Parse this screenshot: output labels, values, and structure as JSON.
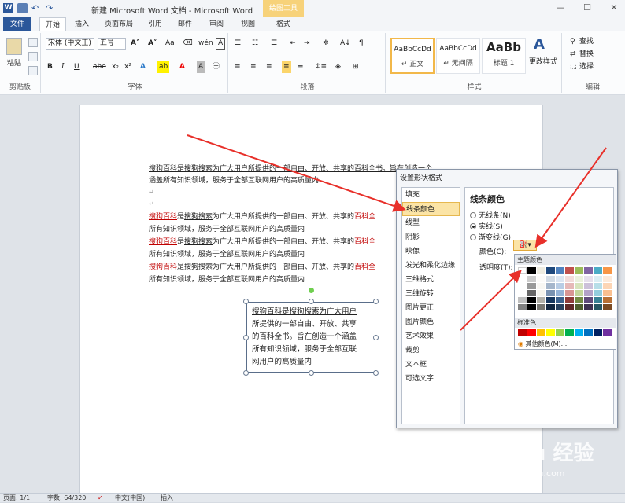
{
  "window": {
    "title": "新建 Microsoft Word 文档 - Microsoft Word",
    "context_tab_group": "绘图工具"
  },
  "tabs": [
    "文件",
    "开始",
    "插入",
    "页面布局",
    "引用",
    "邮件",
    "审阅",
    "视图",
    "格式"
  ],
  "ribbon": {
    "clipboard": {
      "label": "剪贴板",
      "paste": "粘贴"
    },
    "font": {
      "label": "字体",
      "font_name": "宋体 (中文正)",
      "font_size": "五号"
    },
    "paragraph": {
      "label": "段落"
    },
    "styles": {
      "label": "样式",
      "items": [
        {
          "sample": "AaBbCcDd",
          "name": "↵ 正文"
        },
        {
          "sample": "AaBbCcDd",
          "name": "↵ 无间隔"
        },
        {
          "sample": "AaBb",
          "name": "标题 1"
        }
      ],
      "change_styles": "更改样式"
    },
    "editing": {
      "label": "编辑",
      "find": "查找",
      "replace": "替换",
      "select": "选择"
    }
  },
  "document": {
    "para1": "搜狗百科是搜狗搜索为广大用户所提供的一部自由、开放、共享的百科全书。旨在创造一个",
    "para1b": "涵盖所有知识领域，服务于全部互联网用户的高质量内",
    "repeat_head": "搜狗百科",
    "repeat_mid": "是",
    "repeat_link": "搜狗搜索",
    "repeat_tail": "为广大用户所提供的一部自由、开放、共享的",
    "repeat_red": "百科全",
    "repeat_line2": "所有知识领域，服务于全部互联网用户的高质量内",
    "textbox_lines": [
      "搜狗百科是搜狗搜索为广大用户",
      "所提供的一部自由、开放、共享",
      "的百科全书。旨在创造一个涵盖",
      "所有知识领域，服务于全部互联",
      "网用户的高质量内"
    ]
  },
  "dialog": {
    "title": "设置形状格式",
    "nav": [
      "填充",
      "线条颜色",
      "线型",
      "阴影",
      "映像",
      "发光和柔化边缘",
      "三维格式",
      "三维旋转",
      "图片更正",
      "图片颜色",
      "艺术效果",
      "裁剪",
      "文本框",
      "可选文字"
    ],
    "selected_nav": "线条颜色",
    "panel_title": "线条颜色",
    "options": [
      "无线条(N)",
      "实线(S)",
      "渐变线(G)"
    ],
    "selected_option": "实线(S)",
    "color_label": "颜色(C):",
    "transparency_label": "透明度(T):",
    "palette": {
      "theme_header": "主题颜色",
      "standard_header": "标准色",
      "more_colors": "其他颜色(M)...",
      "theme_top": [
        "#ffffff",
        "#000000",
        "#eeece1",
        "#1f497d",
        "#4f81bd",
        "#c0504d",
        "#9bbb59",
        "#8064a2",
        "#4bacc6",
        "#f79646"
      ],
      "standard": [
        "#c00000",
        "#ff0000",
        "#ffc000",
        "#ffff00",
        "#92d050",
        "#00b050",
        "#00b0f0",
        "#0070c0",
        "#002060",
        "#7030a0"
      ]
    }
  },
  "statusbar": {
    "page": "页面: 1/1",
    "words": "字数: 64/320",
    "lang": "中文(中国)",
    "mode": "插入"
  },
  "watermark": {
    "brand": "Baidu 经验",
    "url": "jingyan.baidu.com"
  },
  "annotation_color": "#e8302a"
}
